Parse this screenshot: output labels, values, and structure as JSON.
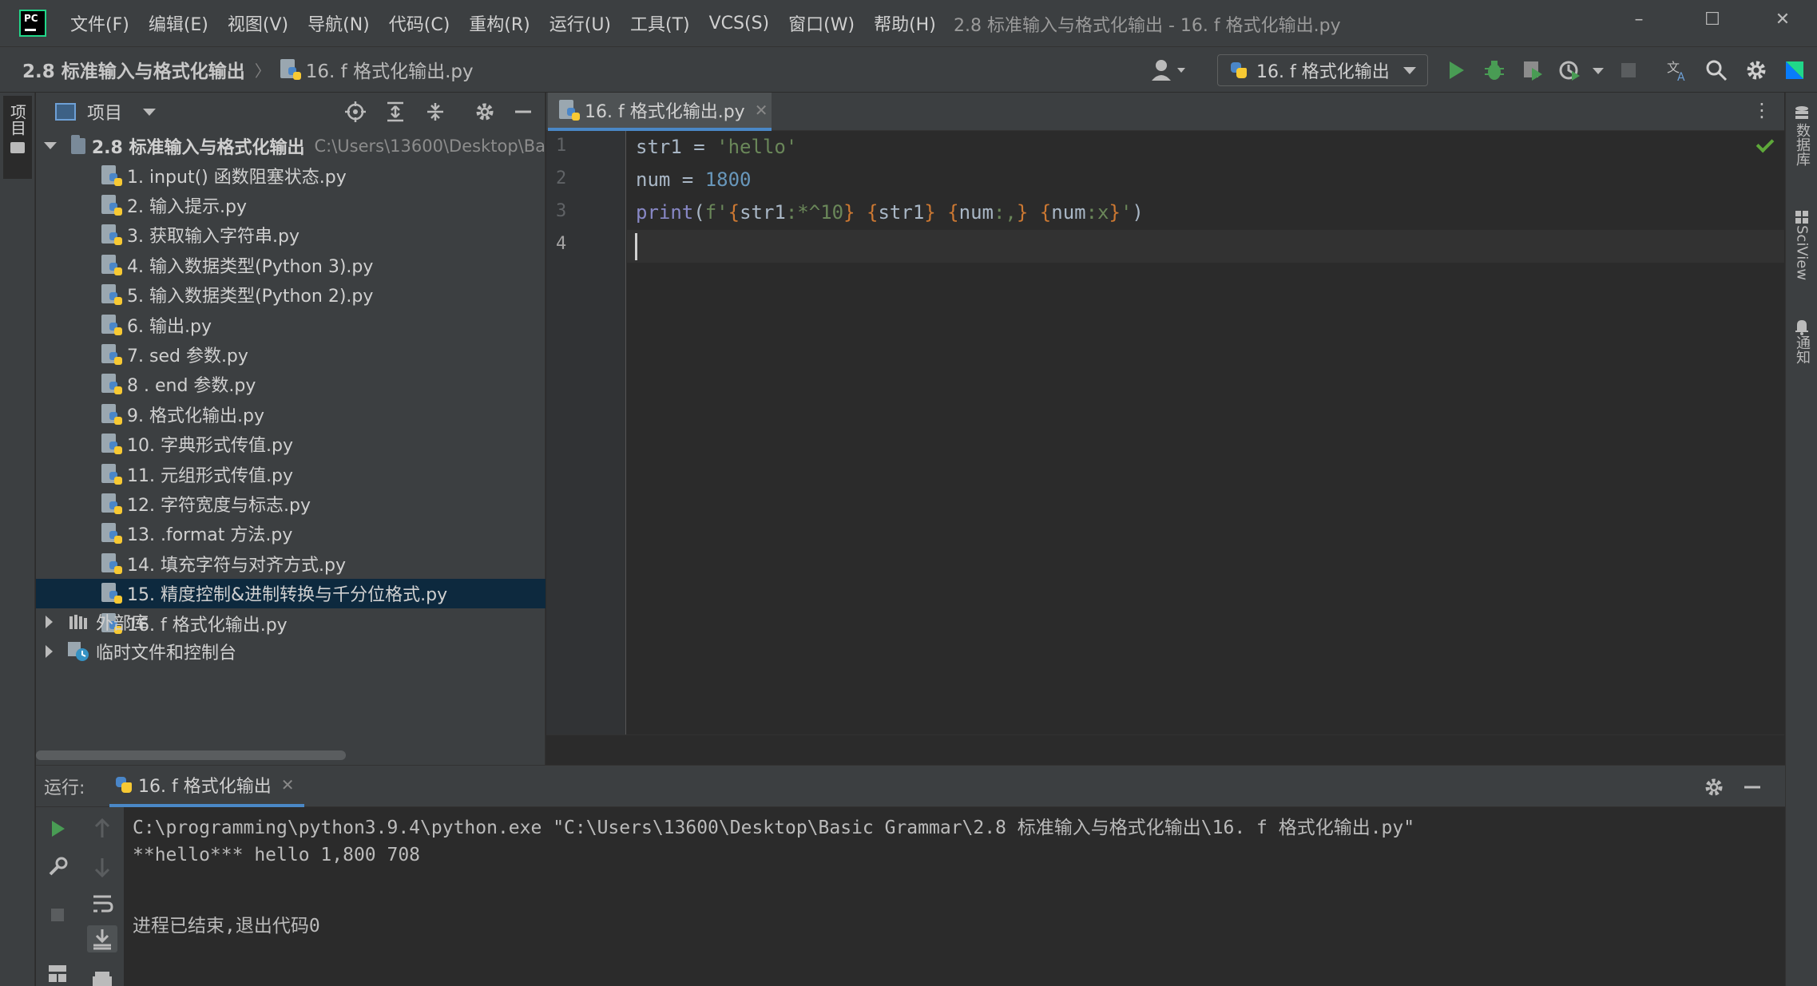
{
  "menu": {
    "items": [
      "文件(F)",
      "编辑(E)",
      "视图(V)",
      "导航(N)",
      "代码(C)",
      "重构(R)",
      "运行(U)",
      "工具(T)",
      "VCS(S)",
      "窗口(W)",
      "帮助(H)"
    ],
    "window_title": "2.8 标准输入与格式化输出 - 16. f 格式化输出.py",
    "logo_text": "PC"
  },
  "navbar": {
    "project_crumb": "2.8 标准输入与格式化输出",
    "file_crumb": "16. f 格式化输出.py",
    "run_config": "16. f 格式化输出"
  },
  "left_strip": {
    "project_label": "项目"
  },
  "right_strip": {
    "database": "数据库",
    "sciview": "SciView",
    "notifications": "通知"
  },
  "project_panel": {
    "title": "项目",
    "root": {
      "name": "2.8 标准输入与格式化输出",
      "path": "C:\\Users\\13600\\Desktop\\Ba"
    },
    "files": [
      "1. input() 函数阻塞状态.py",
      "2. 输入提示.py",
      "3. 获取输入字符串.py",
      "4. 输入数据类型(Python 3).py",
      "5. 输入数据类型(Python 2).py",
      "6. 输出.py",
      "7. sed 参数.py",
      "8 . end 参数.py",
      "9. 格式化输出.py",
      "10. 字典形式传值.py",
      "11. 元组形式传值.py",
      "12. 字符宽度与标志.py",
      "13. .format 方法.py",
      "14. 填充字符与对齐方式.py",
      "15. 精度控制&进制转换与千分位格式.py",
      "16. f 格式化输出.py"
    ],
    "selected_index": 14,
    "external_libs": "外部库",
    "scratches": "临时文件和控制台"
  },
  "editor": {
    "tab_label": "16. f 格式化输出.py",
    "line_numbers": [
      "1",
      "2",
      "3",
      "4"
    ],
    "code": {
      "l1_a": "str1 = ",
      "l1_b": "'hello'",
      "l2_a": "num = ",
      "l2_b": "1800",
      "l3_print": "print",
      "l3_open": "(",
      "l3_fq": "f'",
      "l3_b1o": "{",
      "l3_v1": "str1",
      "l3_f1": ":*^10",
      "l3_b1c": "}",
      "l3_sp1": " ",
      "l3_b2o": "{",
      "l3_v2": "str1",
      "l3_b2c": "}",
      "l3_sp2": " ",
      "l3_b3o": "{",
      "l3_v3": "num",
      "l3_f3": ":,",
      "l3_b3c": "}",
      "l3_sp3": " ",
      "l3_b4o": "{",
      "l3_v4": "num",
      "l3_f4": ":x",
      "l3_b4c": "}",
      "l3_eq": "'",
      "l3_close": ")"
    }
  },
  "run_panel": {
    "label": "运行:",
    "tab_label": "16. f 格式化输出",
    "console": [
      "C:\\programming\\python3.9.4\\python.exe \"C:\\Users\\13600\\Desktop\\Basic Grammar\\2.8 标准输入与格式化输出\\16. f 格式化输出.py\"",
      "**hello*** hello 1,800 708",
      "",
      "进程已结束,退出代码0"
    ]
  },
  "colors": {
    "bg": "#2b2b2b",
    "panel": "#3c3f41",
    "accent": "#4a88c7",
    "selection": "#0d293e",
    "string": "#6a8759",
    "number": "#6897bb",
    "builtin": "#8888c6",
    "run_green": "#499c54"
  }
}
